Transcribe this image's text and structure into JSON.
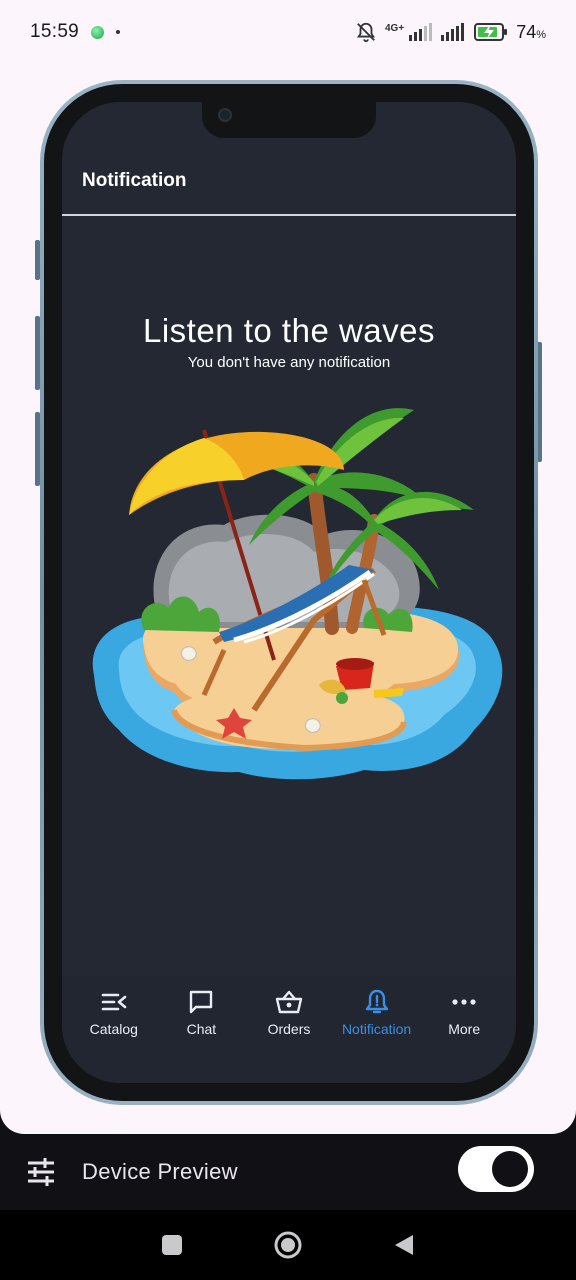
{
  "status_bar": {
    "time": "15:59",
    "network": "4G+",
    "battery_percent": "74",
    "battery_suffix": "%"
  },
  "app": {
    "title": "Notification",
    "empty_state": {
      "title": "Listen to the waves",
      "subtitle": "You don't have any notification",
      "illustration": "beach-island-illustration"
    }
  },
  "bottom_nav": {
    "items": [
      {
        "label": "Catalog",
        "icon": "catalog-icon",
        "active": false
      },
      {
        "label": "Chat",
        "icon": "chat-icon",
        "active": false
      },
      {
        "label": "Orders",
        "icon": "basket-icon",
        "active": false
      },
      {
        "label": "Notification",
        "icon": "bell-alert-icon",
        "active": true
      },
      {
        "label": "More",
        "icon": "more-horizontal-icon",
        "active": false
      }
    ],
    "active_color": "#3b8ee6"
  },
  "device_preview": {
    "label": "Device Preview",
    "toggle_on": true,
    "icon": "sliders-icon"
  },
  "colors": {
    "screen_bg": "#232833",
    "page_bg": "#fcf6fc",
    "toolbar_bg": "#111015"
  }
}
